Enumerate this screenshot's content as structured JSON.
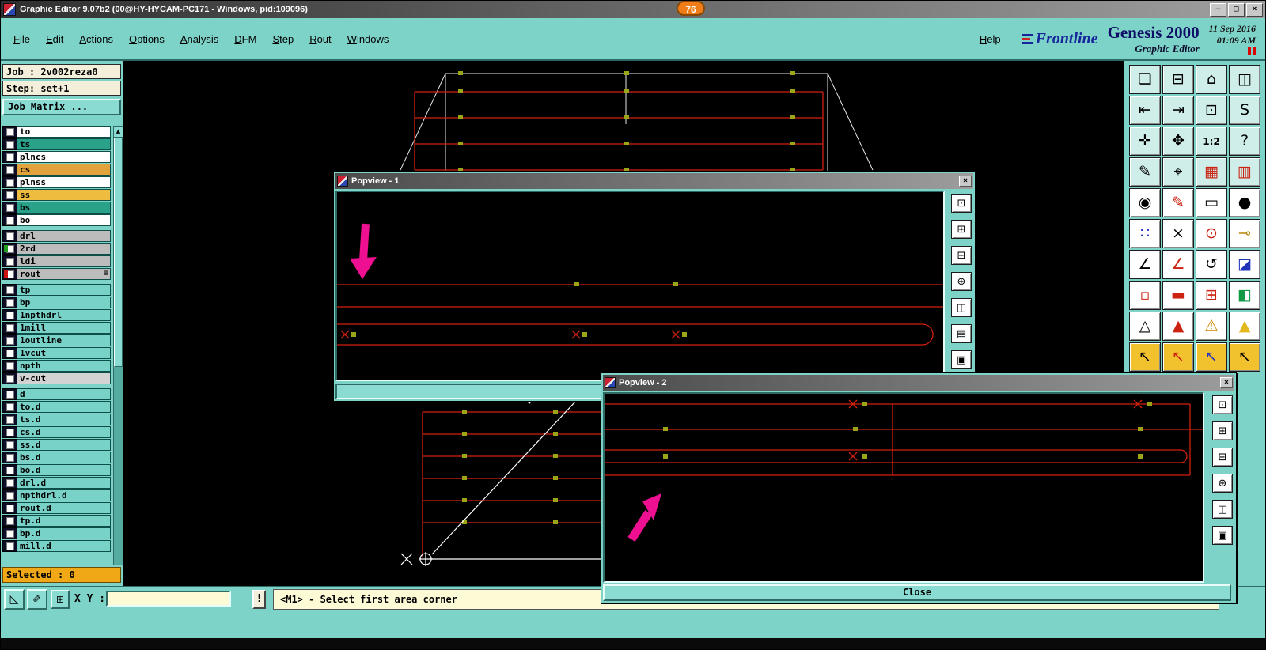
{
  "window": {
    "title": "Graphic Editor 9.07b2 (00@HY-HYCAM-PC171 - Windows, pid:109096)",
    "badge": "76",
    "controls": {
      "minimize": "–",
      "maximize": "□",
      "close": "×"
    }
  },
  "menubar": {
    "items": [
      "File",
      "Edit",
      "Actions",
      "Options",
      "Analysis",
      "DFM",
      "Step",
      "Rout",
      "Windows"
    ],
    "help": "Help"
  },
  "brand": {
    "logo": "Frontline",
    "product": "Genesis 2000",
    "subtitle": "Graphic Editor",
    "date": "11 Sep 2016",
    "time": "01:09 AM"
  },
  "sidebar": {
    "job": "Job : 2v002reza0",
    "step": "Step: set+1",
    "job_matrix": "Job Matrix ...",
    "selected": "Selected : 0",
    "layers": [
      {
        "name": "to",
        "color": "#ffffff"
      },
      {
        "name": "ts",
        "color": "#2aa189"
      },
      {
        "name": "plncs",
        "color": "#ffffff"
      },
      {
        "name": "cs",
        "color": "#e2a33c"
      },
      {
        "name": "plnss",
        "color": "#ffffff"
      },
      {
        "name": "ss",
        "color": "#eebc3e"
      },
      {
        "name": "bs",
        "color": "#2aa189"
      },
      {
        "name": "bo",
        "color": "#ffffff",
        "gap_after": true
      },
      {
        "name": "drl",
        "color": "#bcbcbc"
      },
      {
        "name": "2rd",
        "color": "#bcbcbc",
        "indicator": "#1f9e1f"
      },
      {
        "name": "ldi",
        "color": "#bcbcbc"
      },
      {
        "name": "rout",
        "color": "#bcbcbc",
        "indicator": "#cc1111",
        "suffix": "≡",
        "gap_after": true
      },
      {
        "name": "tp",
        "color": "#79d2c8"
      },
      {
        "name": "bp",
        "color": "#79d2c8"
      },
      {
        "name": "1npthdrl",
        "color": "#79d2c8"
      },
      {
        "name": "1mill",
        "color": "#79d2c8"
      },
      {
        "name": "1outline",
        "color": "#79d2c8"
      },
      {
        "name": "1vcut",
        "color": "#79d2c8"
      },
      {
        "name": "npth",
        "color": "#79d2c8"
      },
      {
        "name": "v-cut",
        "color": "#d3d3d3",
        "gap_after": true
      },
      {
        "name": "d",
        "color": "#79d2c8"
      },
      {
        "name": "to.d",
        "color": "#79d2c8"
      },
      {
        "name": "ts.d",
        "color": "#79d2c8"
      },
      {
        "name": "cs.d",
        "color": "#79d2c8"
      },
      {
        "name": "ss.d",
        "color": "#79d2c8"
      },
      {
        "name": "bs.d",
        "color": "#79d2c8"
      },
      {
        "name": "bo.d",
        "color": "#79d2c8"
      },
      {
        "name": "drl.d",
        "color": "#79d2c8"
      },
      {
        "name": "npthdrl.d",
        "color": "#79d2c8"
      },
      {
        "name": "rout.d",
        "color": "#79d2c8"
      },
      {
        "name": "tp.d",
        "color": "#79d2c8"
      },
      {
        "name": "bp.d",
        "color": "#79d2c8"
      },
      {
        "name": "mill.d",
        "color": "#79d2c8"
      }
    ]
  },
  "statusbar": {
    "xy_label": "X Y :",
    "xy_value": "",
    "alert": "!",
    "message": "<M1> - Select first area corner",
    "tools": [
      {
        "name": "area-corner-icon",
        "glyph": "◺"
      },
      {
        "name": "measure-pencil-icon",
        "glyph": "✐"
      },
      {
        "name": "quad-view-icon",
        "glyph": "⊞"
      }
    ]
  },
  "popview1": {
    "title": "Popview - 1",
    "close": "×",
    "tools": [
      {
        "name": "pv-fullscreen-icon",
        "glyph": "⊡"
      },
      {
        "name": "pv-zoom-in-icon",
        "glyph": "⊞"
      },
      {
        "name": "pv-zoom-out-icon",
        "glyph": "⊟"
      },
      {
        "name": "pv-pan-icon",
        "glyph": "⊕"
      },
      {
        "name": "pv-prev-view-icon",
        "glyph": "◫"
      },
      {
        "name": "pv-layers-icon",
        "glyph": "▤"
      },
      {
        "name": "pv-snapshot-icon",
        "glyph": "▣"
      }
    ]
  },
  "popview2": {
    "title": "Popview - 2",
    "close": "×",
    "close_button": "Close",
    "tools": [
      {
        "name": "pv-fullscreen-icon",
        "glyph": "⊡"
      },
      {
        "name": "pv-zoom-in-icon",
        "glyph": "⊞"
      },
      {
        "name": "pv-zoom-out-icon",
        "glyph": "⊟"
      },
      {
        "name": "pv-pan-icon",
        "glyph": "⊕"
      },
      {
        "name": "pv-prev-view-icon",
        "glyph": "◫"
      },
      {
        "name": "pv-snapshot-icon",
        "glyph": "▣"
      }
    ]
  },
  "right_toolbar": {
    "icons": [
      {
        "name": "cascade-windows-icon",
        "glyph": "❏",
        "bg": "#cfeeea"
      },
      {
        "name": "monitor-icon",
        "glyph": "⊟",
        "bg": "#cfeeea"
      },
      {
        "name": "home-view-icon",
        "glyph": "⌂",
        "bg": "#cfeeea"
      },
      {
        "name": "tile-windows-icon",
        "glyph": "◫",
        "bg": "#cfeeea"
      },
      {
        "name": "zoom-prev-icon",
        "glyph": "⇤",
        "bg": "#cfeeea"
      },
      {
        "name": "zoom-next-icon",
        "glyph": "⇥",
        "bg": "#cfeeea"
      },
      {
        "name": "window-zoom-icon",
        "glyph": "⊡",
        "bg": "#cfeeea"
      },
      {
        "name": "serpentine-icon",
        "glyph": "S",
        "bg": "#cfeeea"
      },
      {
        "name": "fit-view-icon",
        "glyph": "✛",
        "bg": "#cfeeea"
      },
      {
        "name": "pan-view-icon",
        "glyph": "✥",
        "bg": "#cfeeea"
      },
      {
        "name": "zoom-ratio-icon",
        "glyph": "1:2",
        "bg": "#cfeeea"
      },
      {
        "name": "context-help-icon",
        "glyph": "?",
        "bg": "#cfeeea"
      },
      {
        "name": "measure-pen-icon",
        "glyph": "✎",
        "bg": "#cfeeea"
      },
      {
        "name": "probe-icon",
        "glyph": "⌖",
        "bg": "#cfeeea"
      },
      {
        "name": "highlight-net-icon",
        "glyph": "▦",
        "color": "#cc2211",
        "bg": "#cfeeea"
      },
      {
        "name": "highlight-pads-icon",
        "glyph": "▥",
        "color": "#cc2211",
        "bg": "#cfeeea"
      },
      {
        "name": "snapshot-icon",
        "glyph": "◉"
      },
      {
        "name": "redline-pen-icon",
        "glyph": "✎",
        "color": "#cc2211"
      },
      {
        "name": "ruler-icon",
        "glyph": "▭"
      },
      {
        "name": "filled-dot-icon",
        "glyph": "●"
      },
      {
        "name": "net-points-icon",
        "glyph": "∷",
        "color": "#2233bb"
      },
      {
        "name": "delete-icon",
        "glyph": "×"
      },
      {
        "name": "center-target-icon",
        "glyph": "⊙",
        "color": "#cc2211"
      },
      {
        "name": "key-icon",
        "glyph": "⊸",
        "color": "#b8860b"
      },
      {
        "name": "slope-measure-icon",
        "glyph": "∠"
      },
      {
        "name": "slope-red-icon",
        "glyph": "∠",
        "color": "#cc2211"
      },
      {
        "name": "rotate-icon",
        "glyph": "↺"
      },
      {
        "name": "half-fill-icon",
        "glyph": "◪",
        "color": "#2233bb"
      },
      {
        "name": "small-rect-icon",
        "glyph": "▫",
        "color": "#cc2211"
      },
      {
        "name": "dash-icon",
        "glyph": "▬",
        "color": "#cc2211"
      },
      {
        "name": "cross-window-icon",
        "glyph": "⊞",
        "color": "#cc2211"
      },
      {
        "name": "layers-color-icon",
        "glyph": "◧",
        "color": "#119944"
      },
      {
        "name": "triangle-outline-icon",
        "glyph": "△"
      },
      {
        "name": "triangle-red-icon",
        "glyph": "▲",
        "color": "#cc2211"
      },
      {
        "name": "warning-icon",
        "glyph": "⚠",
        "color": "#cc8800"
      },
      {
        "name": "triangle-yellow-icon",
        "glyph": "▲",
        "color": "#e3b71e"
      },
      {
        "name": "cursor-black-icon",
        "glyph": "↖",
        "bg": "#f2c12e"
      },
      {
        "name": "cursor-red-icon",
        "glyph": "↖",
        "color": "#cc2211",
        "bg": "#f2c12e"
      },
      {
        "name": "cursor-blue-icon",
        "glyph": "↖",
        "color": "#2233bb",
        "bg": "#f2c12e"
      },
      {
        "name": "cursor-select-icon",
        "glyph": "↖",
        "bg": "#f2c12e"
      }
    ]
  }
}
